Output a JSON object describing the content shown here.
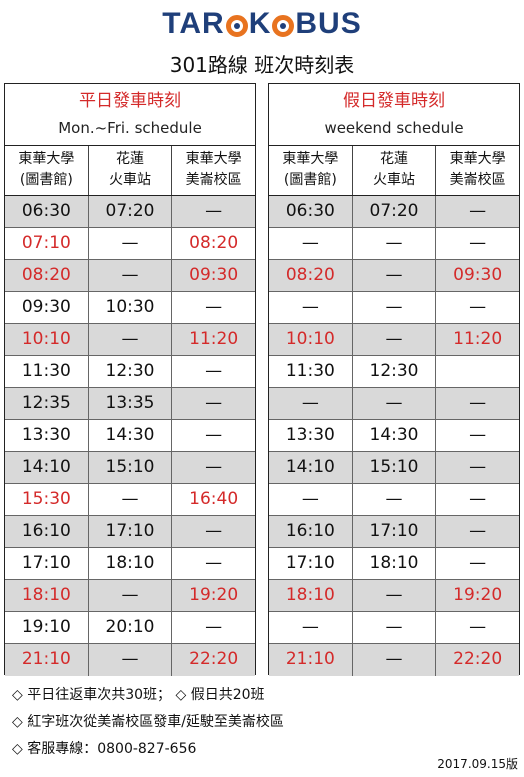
{
  "logo": {
    "part1": "TAR",
    "part2": "K",
    "part3": "BUS"
  },
  "title": "301路線 班次時刻表",
  "weekday": {
    "title": "平日發車時刻",
    "subtitle": "Mon.~Fri. schedule",
    "columns": [
      "東華大學\n(圖書館)",
      "花蓮\n火車站",
      "東華大學\n美崙校區"
    ],
    "rows": [
      {
        "cells": [
          "06:30",
          "07:20",
          "—"
        ],
        "shade": true,
        "red": [
          false,
          false,
          false
        ]
      },
      {
        "cells": [
          "07:10",
          "—",
          "08:20"
        ],
        "shade": false,
        "red": [
          true,
          false,
          true
        ]
      },
      {
        "cells": [
          "08:20",
          "—",
          "09:30"
        ],
        "shade": true,
        "red": [
          true,
          false,
          true
        ]
      },
      {
        "cells": [
          "09:30",
          "10:30",
          "—"
        ],
        "shade": false,
        "red": [
          false,
          false,
          false
        ]
      },
      {
        "cells": [
          "10:10",
          "—",
          "11:20"
        ],
        "shade": true,
        "red": [
          true,
          false,
          true
        ]
      },
      {
        "cells": [
          "11:30",
          "12:30",
          "—"
        ],
        "shade": false,
        "red": [
          false,
          false,
          false
        ]
      },
      {
        "cells": [
          "12:35",
          "13:35",
          "—"
        ],
        "shade": true,
        "red": [
          false,
          false,
          false
        ]
      },
      {
        "cells": [
          "13:30",
          "14:30",
          "—"
        ],
        "shade": false,
        "red": [
          false,
          false,
          false
        ]
      },
      {
        "cells": [
          "14:10",
          "15:10",
          "—"
        ],
        "shade": true,
        "red": [
          false,
          false,
          false
        ]
      },
      {
        "cells": [
          "15:30",
          "—",
          "16:40"
        ],
        "shade": false,
        "red": [
          true,
          false,
          true
        ]
      },
      {
        "cells": [
          "16:10",
          "17:10",
          "—"
        ],
        "shade": true,
        "red": [
          false,
          false,
          false
        ]
      },
      {
        "cells": [
          "17:10",
          "18:10",
          "—"
        ],
        "shade": false,
        "red": [
          false,
          false,
          false
        ]
      },
      {
        "cells": [
          "18:10",
          "—",
          "19:20"
        ],
        "shade": true,
        "red": [
          true,
          false,
          true
        ]
      },
      {
        "cells": [
          "19:10",
          "20:10",
          "—"
        ],
        "shade": false,
        "red": [
          false,
          false,
          false
        ]
      },
      {
        "cells": [
          "21:10",
          "—",
          "22:20"
        ],
        "shade": true,
        "red": [
          true,
          false,
          true
        ]
      }
    ]
  },
  "weekend": {
    "title": "假日發車時刻",
    "subtitle": "weekend schedule",
    "columns": [
      "東華大學\n(圖書館)",
      "花蓮\n火車站",
      "東華大學\n美崙校區"
    ],
    "rows": [
      {
        "cells": [
          "06:30",
          "07:20",
          "—"
        ],
        "shade": true,
        "red": [
          false,
          false,
          false
        ]
      },
      {
        "cells": [
          "—",
          "—",
          "—"
        ],
        "shade": false,
        "red": [
          false,
          false,
          false
        ]
      },
      {
        "cells": [
          "08:20",
          "—",
          "09:30"
        ],
        "shade": true,
        "red": [
          true,
          false,
          true
        ]
      },
      {
        "cells": [
          "—",
          "—",
          "—"
        ],
        "shade": false,
        "red": [
          false,
          false,
          false
        ]
      },
      {
        "cells": [
          "10:10",
          "—",
          "11:20"
        ],
        "shade": true,
        "red": [
          true,
          false,
          true
        ]
      },
      {
        "cells": [
          "11:30",
          "12:30",
          ""
        ],
        "shade": false,
        "red": [
          false,
          false,
          false
        ]
      },
      {
        "cells": [
          "—",
          "—",
          "—"
        ],
        "shade": true,
        "red": [
          false,
          false,
          false
        ]
      },
      {
        "cells": [
          "13:30",
          "14:30",
          "—"
        ],
        "shade": false,
        "red": [
          false,
          false,
          false
        ]
      },
      {
        "cells": [
          "14:10",
          "15:10",
          "—"
        ],
        "shade": true,
        "red": [
          false,
          false,
          false
        ]
      },
      {
        "cells": [
          "—",
          "—",
          "—"
        ],
        "shade": false,
        "red": [
          false,
          false,
          false
        ]
      },
      {
        "cells": [
          "16:10",
          "17:10",
          "—"
        ],
        "shade": true,
        "red": [
          false,
          false,
          false
        ]
      },
      {
        "cells": [
          "17:10",
          "18:10",
          "—"
        ],
        "shade": false,
        "red": [
          false,
          false,
          false
        ]
      },
      {
        "cells": [
          "18:10",
          "—",
          "19:20"
        ],
        "shade": true,
        "red": [
          true,
          false,
          true
        ]
      },
      {
        "cells": [
          "—",
          "—",
          "—"
        ],
        "shade": false,
        "red": [
          false,
          false,
          false
        ]
      },
      {
        "cells": [
          "21:10",
          "—",
          "22:20"
        ],
        "shade": true,
        "red": [
          true,
          false,
          true
        ]
      }
    ]
  },
  "notes": [
    "◇ 平日往返車次共30班； ◇ 假日共20班",
    "◇ 紅字班次從美崙校區發車/延駛至美崙校區",
    "◇ 客服專線：0800-827-656"
  ],
  "version": "2017.09.15版",
  "colors": {
    "red": "#d42a2a",
    "shade": "#d9d9d9",
    "logo_blue": "#1f3f7a",
    "logo_orange": "#e8731f"
  }
}
